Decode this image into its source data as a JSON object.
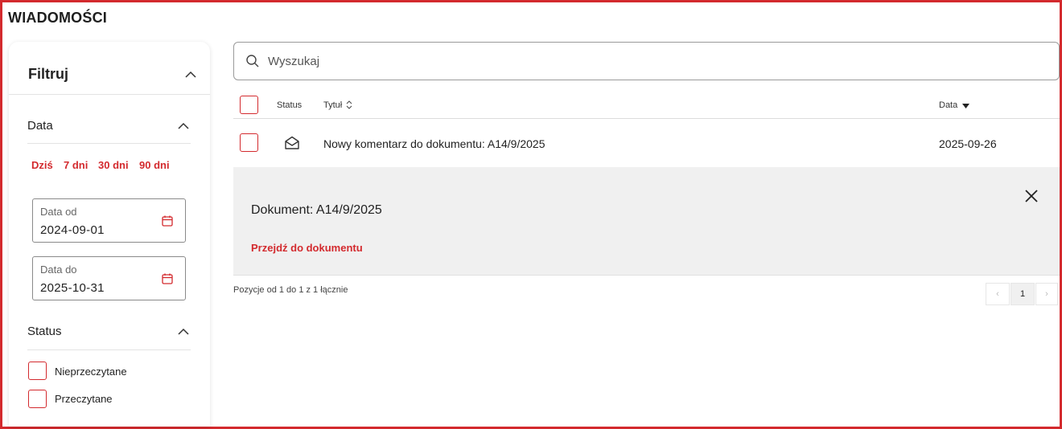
{
  "page": {
    "title": "WIADOMOŚCI"
  },
  "filters": {
    "title": "Filtruj",
    "date_section": {
      "title": "Data",
      "quick": [
        "Dziś",
        "7 dni",
        "30 dni",
        "90 dni"
      ],
      "from": {
        "label": "Data od",
        "value": "2024-09-01"
      },
      "to": {
        "label": "Data do",
        "value": "2025-10-31"
      }
    },
    "status_section": {
      "title": "Status",
      "options": [
        "Nieprzeczytane",
        "Przeczytane"
      ]
    }
  },
  "search": {
    "placeholder": "Wyszukaj"
  },
  "table": {
    "columns": {
      "status": "Status",
      "title": "Tytuł",
      "date": "Data"
    },
    "rows": [
      {
        "title": "Nowy komentarz do dokumentu: A14/9/2025",
        "date": "2025-09-26",
        "status_icon": "envelope-open-icon"
      }
    ]
  },
  "detail": {
    "title": "Dokument: A14/9/2025",
    "link": "Przejdź do dokumentu"
  },
  "footer": {
    "summary": "Pozycje od 1 do 1 z 1 łącznie",
    "pagination": {
      "prev": "‹",
      "current": "1",
      "next": "›"
    }
  },
  "colors": {
    "accent": "#d32a2e",
    "detail_bg": "#f0f0f0",
    "border": "#dcdcdc"
  }
}
